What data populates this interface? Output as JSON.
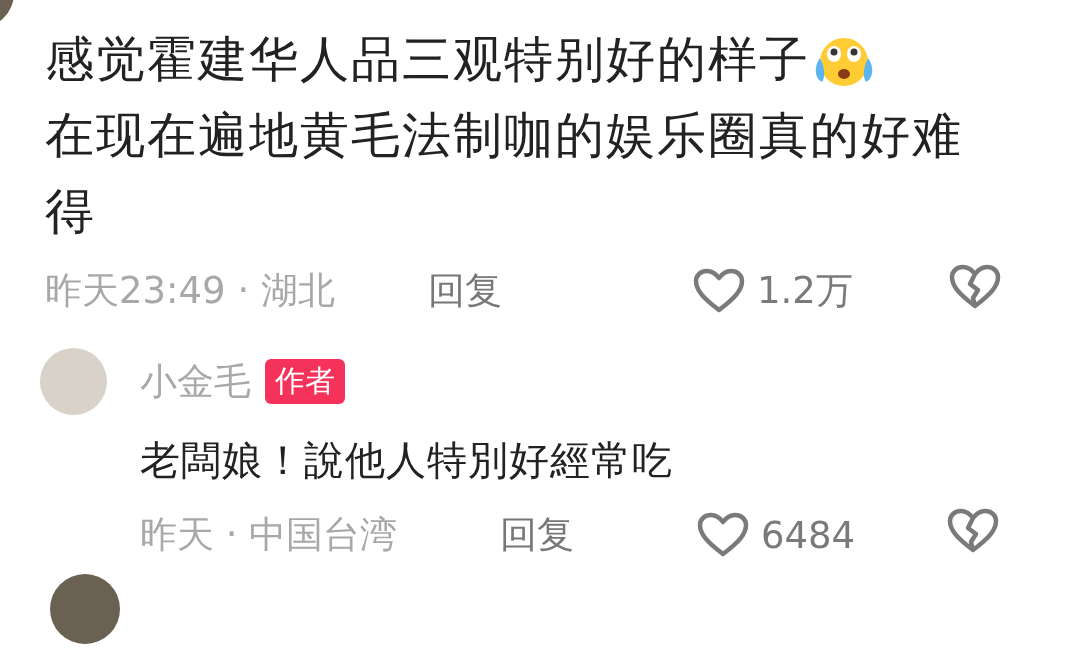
{
  "comment": {
    "text_lines": [
      "感觉霍建华人品三观特别好的样子",
      "在现在遍地黄毛法制咖的娱乐圈真的好难得"
    ],
    "time_location": "昨天23:49 · 湖北",
    "reply_label": "回复",
    "likes": "1.2万"
  },
  "reply": {
    "author": "小金毛",
    "author_badge": "作者",
    "text": "老闆娘！說他人特別好經常吃",
    "time_location": "昨天 · 中国台湾",
    "reply_label": "回复",
    "likes": "6484"
  }
}
